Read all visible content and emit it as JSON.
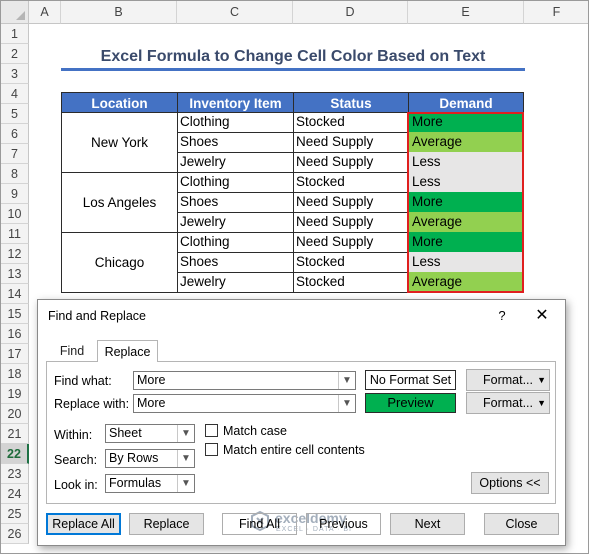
{
  "sheet": {
    "columns": [
      "A",
      "B",
      "C",
      "D",
      "E",
      "F"
    ],
    "rows": [
      "1",
      "2",
      "3",
      "4",
      "5",
      "6",
      "7",
      "8",
      "9",
      "10",
      "11",
      "12",
      "13",
      "14",
      "15",
      "16",
      "17",
      "18",
      "19",
      "20",
      "21",
      "22",
      "23",
      "24",
      "25",
      "26"
    ],
    "active_row": "22",
    "title": "Excel Formula to Change Cell Color Based on Text",
    "headers": [
      "Location",
      "Inventory Item",
      "Status",
      "Demand"
    ],
    "groups": [
      {
        "location": "New York",
        "rows": [
          {
            "item": "Clothing",
            "status": "Stocked",
            "demand": "More"
          },
          {
            "item": "Shoes",
            "status": "Need Supply",
            "demand": "Average"
          },
          {
            "item": "Jewelry",
            "status": "Need Supply",
            "demand": "Less"
          }
        ]
      },
      {
        "location": "Los Angeles",
        "rows": [
          {
            "item": "Clothing",
            "status": "Stocked",
            "demand": "Less"
          },
          {
            "item": "Shoes",
            "status": "Need Supply",
            "demand": "More"
          },
          {
            "item": "Jewelry",
            "status": "Need Supply",
            "demand": "Average"
          }
        ]
      },
      {
        "location": "Chicago",
        "rows": [
          {
            "item": "Clothing",
            "status": "Need Supply",
            "demand": "More"
          },
          {
            "item": "Shoes",
            "status": "Stocked",
            "demand": "Less"
          },
          {
            "item": "Jewelry",
            "status": "Stocked",
            "demand": "Average"
          }
        ]
      }
    ],
    "demand_colors": {
      "More": "#00b050",
      "Average": "#92d050",
      "Less": "#e7e6e6"
    },
    "colors": {
      "header_bg": "#4472c4",
      "title_text": "#3a4a6b",
      "outline": "#e01f1f"
    }
  },
  "dialog": {
    "title": "Find and Replace",
    "help_glyph": "?",
    "close_glyph": "✕",
    "tabs": [
      "Find",
      "Replace"
    ],
    "active_tab": "Replace",
    "find_label": "Find what:",
    "find_value": "More",
    "replace_label": "Replace with:",
    "replace_value": "More",
    "no_format": "No Format Set",
    "preview": "Preview",
    "format_label": "Format...",
    "within_label": "Within:",
    "within_value": "Sheet",
    "search_label": "Search:",
    "search_value": "By Rows",
    "lookin_label": "Look in:",
    "lookin_value": "Formulas",
    "match_case": "Match case",
    "match_entire": "Match entire cell contents",
    "options_button": "Options <<",
    "buttons": {
      "replace_all": "Replace All",
      "replace": "Replace",
      "find_all": "Find All",
      "previous": "Previous",
      "next": "Next",
      "close": "Close"
    },
    "watermark": {
      "name": "exceldemy",
      "tagline": "EXCEL · DATA · BI"
    }
  }
}
